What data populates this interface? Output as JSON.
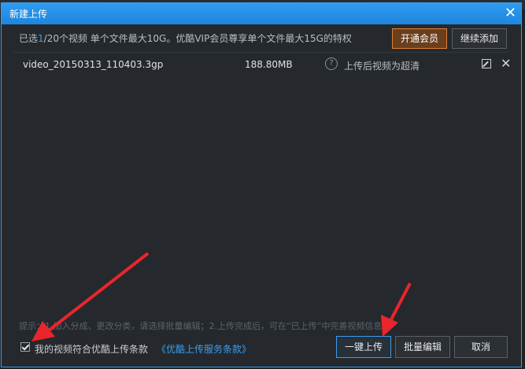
{
  "window": {
    "title": "新建上传",
    "close_glyph": "✕"
  },
  "info": {
    "prefix": "已选",
    "selected_count": "1",
    "suffix": "/20个视频   单个文件最大10G。优酷VIP会员尊享单个文件最大15G的特权",
    "vip_button": "开通会员",
    "add_button": "继续添加"
  },
  "files": [
    {
      "name": "video_20150313_110403.3gp",
      "size": "188.80MB",
      "help_glyph": "?",
      "note": "上传后视频为超清",
      "delete_glyph": "✕"
    }
  ],
  "footer": {
    "tip": "提示：1.加入分成、更改分类，请选择批量编辑；2.上传完成后，可在“已上传”中完善视频信息；",
    "agree_text": "我的视频符合优酷上传条款",
    "terms_link": "《优酷上传服务条款》",
    "checkbox_checked": true,
    "upload_button": "一键上传",
    "batch_edit_button": "批量编辑",
    "cancel_button": "取消"
  },
  "colors": {
    "accent": "#3a9df0",
    "vip": "#e0813a",
    "arrow": "#e8262c"
  },
  "icons": [
    "close-icon",
    "help-icon",
    "edit-icon",
    "delete-icon",
    "checkbox-icon"
  ]
}
